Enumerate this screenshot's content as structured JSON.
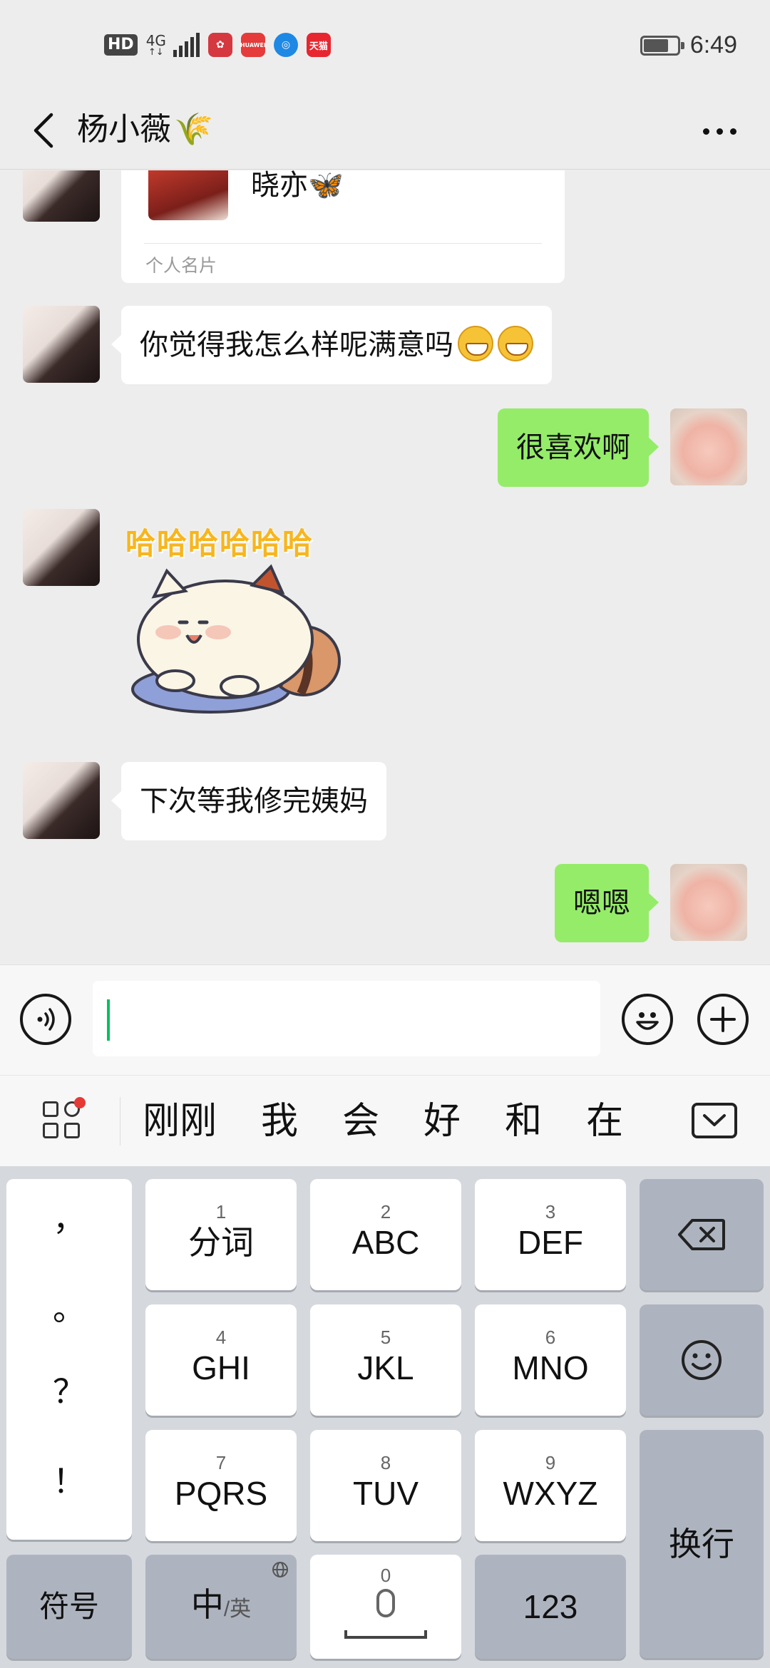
{
  "status_bar": {
    "hd": "HD",
    "network": "4G",
    "network_sub": "↑↓",
    "time": "6:49",
    "battery_level": 0.75,
    "apps": [
      {
        "icon": "lotus-app-icon",
        "color": "#d6383f"
      },
      {
        "icon": "huawei-store-icon",
        "color": "#e53b3b",
        "text": "HUAWEI"
      },
      {
        "icon": "browser-icon",
        "color": "#1e88e5"
      },
      {
        "icon": "tmall-icon",
        "color": "#e7262f",
        "text": "天猫"
      }
    ]
  },
  "header": {
    "title": "杨小薇",
    "title_emoji": "🌾"
  },
  "messages": {
    "card": {
      "name": "晓亦",
      "name_emoji": "🦋",
      "label": "个人名片"
    },
    "m1": {
      "text": "你觉得我怎么样呢满意吗"
    },
    "m2": {
      "text": "很喜欢啊"
    },
    "m3": {
      "sticker_text": "哈哈哈哈哈哈"
    },
    "m4": {
      "text": "下次等我修完姨妈"
    },
    "m5": {
      "text": "嗯嗯"
    }
  },
  "input": {
    "value": ""
  },
  "suggestions": [
    "刚刚",
    "我",
    "会",
    "好",
    "和",
    "在"
  ],
  "keyboard": {
    "punctuation": [
      "，",
      "。",
      "？",
      "！"
    ],
    "keys": [
      {
        "num": "1",
        "label": "分词"
      },
      {
        "num": "2",
        "label": "ABC"
      },
      {
        "num": "3",
        "label": "DEF"
      },
      {
        "num": "4",
        "label": "GHI"
      },
      {
        "num": "5",
        "label": "JKL"
      },
      {
        "num": "6",
        "label": "MNO"
      },
      {
        "num": "7",
        "label": "PQRS"
      },
      {
        "num": "8",
        "label": "TUV"
      },
      {
        "num": "9",
        "label": "WXYZ"
      }
    ],
    "symbols": "符号",
    "lang_main": "中",
    "lang_alt": "/英",
    "space_num": "0",
    "numbers": "123",
    "enter": "换行"
  },
  "colors": {
    "out_bubble": "#95ec69",
    "in_bubble": "#ffffff",
    "background": "#ededed",
    "caret": "#07c160",
    "sticker_text": "#f8b51c"
  }
}
